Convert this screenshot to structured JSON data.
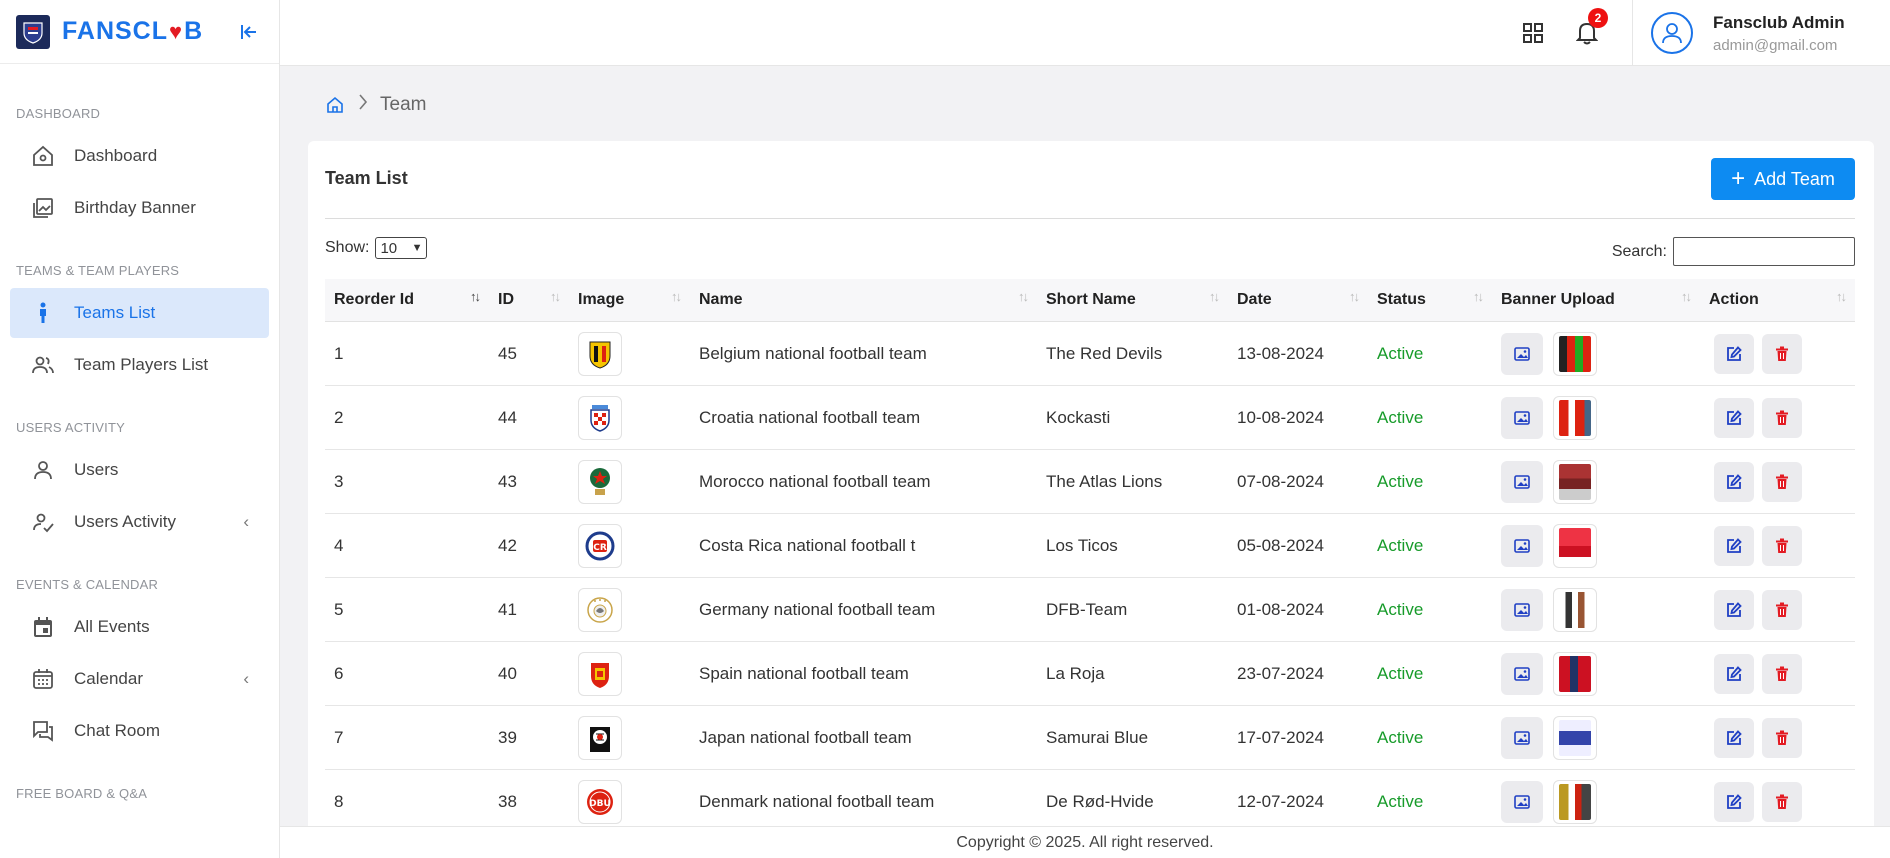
{
  "brand": {
    "name_pre": "FANSCL",
    "heart": "♥",
    "name_post": "B"
  },
  "sidebar": {
    "sections": [
      {
        "label": "DASHBOARD"
      },
      {
        "label": "TEAMS & TEAM PLAYERS"
      },
      {
        "label": "USERS ACTIVITY"
      },
      {
        "label": "EVENTS & CALENDAR"
      },
      {
        "label": "FREE BOARD & Q&A"
      }
    ],
    "items": [
      {
        "label": "Dashboard",
        "icon": "home-icon"
      },
      {
        "label": "Birthday Banner",
        "icon": "gallery-icon"
      },
      {
        "label": "Teams List",
        "icon": "person-icon"
      },
      {
        "label": "Team Players List",
        "icon": "users-icon"
      },
      {
        "label": "Users",
        "icon": "user-icon"
      },
      {
        "label": "Users Activity",
        "icon": "user-check-icon"
      },
      {
        "label": "All Events",
        "icon": "calendar-icon"
      },
      {
        "label": "Calendar",
        "icon": "calendar-grid-icon"
      },
      {
        "label": "Chat Room",
        "icon": "chat-icon"
      }
    ]
  },
  "header": {
    "notification_count": "2",
    "user_name": "Fansclub Admin",
    "user_email": "admin@gmail.com"
  },
  "breadcrumb": {
    "current": "Team"
  },
  "card": {
    "title": "Team List",
    "add_button": "Add Team",
    "show_label": "Show:",
    "page_size": "10",
    "search_label": "Search:"
  },
  "table": {
    "columns": [
      "Reorder Id",
      "ID",
      "Image",
      "Name",
      "Short Name",
      "Date",
      "Status",
      "Banner Upload",
      "Action"
    ],
    "rows": [
      {
        "reorder": "1",
        "id": "45",
        "name": "Belgium national football team",
        "short": "The Red Devils",
        "date": "13-08-2024",
        "status": "Active"
      },
      {
        "reorder": "2",
        "id": "44",
        "name": "Croatia national football team",
        "short": "Kockasti",
        "date": "10-08-2024",
        "status": "Active"
      },
      {
        "reorder": "3",
        "id": "43",
        "name": "Morocco national football team",
        "short": "The Atlas Lions",
        "date": "07-08-2024",
        "status": "Active"
      },
      {
        "reorder": "4",
        "id": "42",
        "name": "Costa Rica national football t",
        "short": "Los Ticos",
        "date": "05-08-2024",
        "status": "Active"
      },
      {
        "reorder": "5",
        "id": "41",
        "name": "Germany national football team",
        "short": "DFB-Team",
        "date": "01-08-2024",
        "status": "Active"
      },
      {
        "reorder": "6",
        "id": "40",
        "name": "Spain national football team",
        "short": "La Roja",
        "date": "23-07-2024",
        "status": "Active"
      },
      {
        "reorder": "7",
        "id": "39",
        "name": "Japan national football team",
        "short": "Samurai Blue",
        "date": "17-07-2024",
        "status": "Active"
      },
      {
        "reorder": "8",
        "id": "38",
        "name": "Denmark national football team",
        "short": "De Rød-Hvide",
        "date": "12-07-2024",
        "status": "Active"
      }
    ]
  },
  "footer": {
    "text": "Copyright © 2025. All right reserved."
  },
  "colors": {
    "primary": "#1a73e8",
    "button": "#0d8bf2",
    "active_status": "#179b2a",
    "danger": "#e31b23"
  }
}
